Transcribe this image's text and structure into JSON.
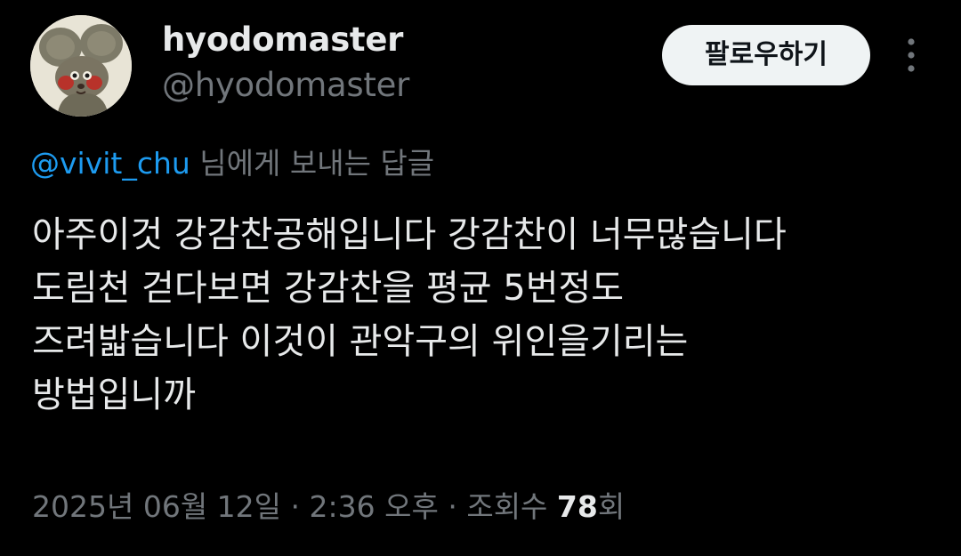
{
  "user": {
    "display_name": "hyodomaster",
    "handle": "@hyodomaster",
    "avatar_icon": "mouse-avatar-icon"
  },
  "actions": {
    "follow_label": "팔로우하기",
    "more_icon": "more-vertical-icon"
  },
  "reply": {
    "mention": "@vivit_chu",
    "suffix": " 님에게 보내는 답글"
  },
  "tweet": {
    "lines": [
      "아주이것 강감찬공해입니다 강감찬이 너무많습니다",
      "도림천 걷다보면 강감찬을 평균 5번정도",
      "즈려밟습니다 이것이 관악구의 위인을기리는",
      "방법입니까"
    ]
  },
  "meta": {
    "date": "2025년 06월 12일",
    "separator": " · ",
    "time": "2:36 오후",
    "views_label": "조회수 ",
    "views_count": "78",
    "views_suffix": "회"
  },
  "colors": {
    "background": "#000000",
    "text_primary": "#e7e9ea",
    "text_secondary": "#71767b",
    "accent_link": "#1d9bf0",
    "follow_button_bg": "#eff3f4",
    "follow_button_text": "#0f1419"
  }
}
